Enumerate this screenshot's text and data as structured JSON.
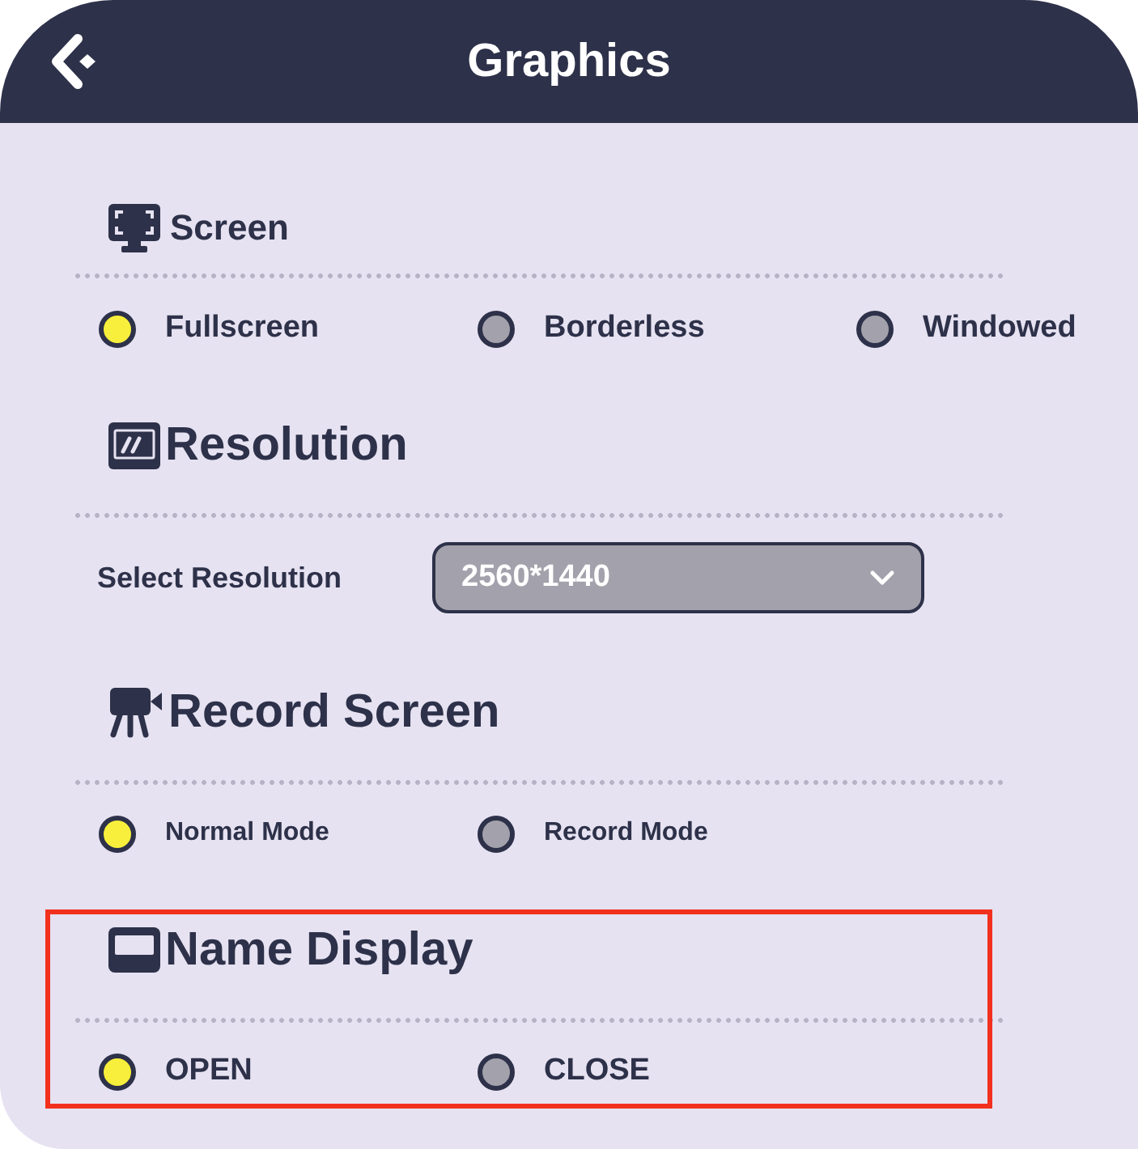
{
  "header": {
    "title": "Graphics"
  },
  "sections": [
    {
      "title": "Screen",
      "kind": "radio",
      "options": [
        {
          "label": "Fullscreen",
          "selected": true
        },
        {
          "label": "Borderless",
          "selected": false
        },
        {
          "label": "Windowed",
          "selected": false
        }
      ]
    },
    {
      "title": "Resolution",
      "kind": "select",
      "label": "Select Resolution",
      "value": "2560*1440"
    },
    {
      "title": "Record Screen",
      "kind": "radio",
      "options": [
        {
          "label": "Normal Mode",
          "selected": true
        },
        {
          "label": "Record Mode",
          "selected": false
        }
      ]
    },
    {
      "title": "Name Display",
      "kind": "radio",
      "highlighted": true,
      "options": [
        {
          "label": "OPEN",
          "selected": true
        },
        {
          "label": "CLOSE",
          "selected": false
        }
      ]
    }
  ]
}
